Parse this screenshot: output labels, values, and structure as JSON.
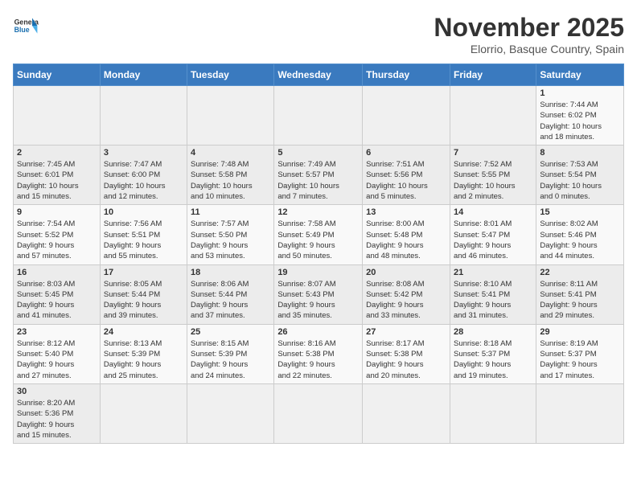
{
  "header": {
    "logo_general": "General",
    "logo_blue": "Blue",
    "month_title": "November 2025",
    "location": "Elorrio, Basque Country, Spain"
  },
  "weekdays": [
    "Sunday",
    "Monday",
    "Tuesday",
    "Wednesday",
    "Thursday",
    "Friday",
    "Saturday"
  ],
  "weeks": [
    [
      {
        "day": "",
        "info": ""
      },
      {
        "day": "",
        "info": ""
      },
      {
        "day": "",
        "info": ""
      },
      {
        "day": "",
        "info": ""
      },
      {
        "day": "",
        "info": ""
      },
      {
        "day": "",
        "info": ""
      },
      {
        "day": "1",
        "info": "Sunrise: 7:44 AM\nSunset: 6:02 PM\nDaylight: 10 hours\nand 18 minutes."
      }
    ],
    [
      {
        "day": "2",
        "info": "Sunrise: 7:45 AM\nSunset: 6:01 PM\nDaylight: 10 hours\nand 15 minutes."
      },
      {
        "day": "3",
        "info": "Sunrise: 7:47 AM\nSunset: 6:00 PM\nDaylight: 10 hours\nand 12 minutes."
      },
      {
        "day": "4",
        "info": "Sunrise: 7:48 AM\nSunset: 5:58 PM\nDaylight: 10 hours\nand 10 minutes."
      },
      {
        "day": "5",
        "info": "Sunrise: 7:49 AM\nSunset: 5:57 PM\nDaylight: 10 hours\nand 7 minutes."
      },
      {
        "day": "6",
        "info": "Sunrise: 7:51 AM\nSunset: 5:56 PM\nDaylight: 10 hours\nand 5 minutes."
      },
      {
        "day": "7",
        "info": "Sunrise: 7:52 AM\nSunset: 5:55 PM\nDaylight: 10 hours\nand 2 minutes."
      },
      {
        "day": "8",
        "info": "Sunrise: 7:53 AM\nSunset: 5:54 PM\nDaylight: 10 hours\nand 0 minutes."
      }
    ],
    [
      {
        "day": "9",
        "info": "Sunrise: 7:54 AM\nSunset: 5:52 PM\nDaylight: 9 hours\nand 57 minutes."
      },
      {
        "day": "10",
        "info": "Sunrise: 7:56 AM\nSunset: 5:51 PM\nDaylight: 9 hours\nand 55 minutes."
      },
      {
        "day": "11",
        "info": "Sunrise: 7:57 AM\nSunset: 5:50 PM\nDaylight: 9 hours\nand 53 minutes."
      },
      {
        "day": "12",
        "info": "Sunrise: 7:58 AM\nSunset: 5:49 PM\nDaylight: 9 hours\nand 50 minutes."
      },
      {
        "day": "13",
        "info": "Sunrise: 8:00 AM\nSunset: 5:48 PM\nDaylight: 9 hours\nand 48 minutes."
      },
      {
        "day": "14",
        "info": "Sunrise: 8:01 AM\nSunset: 5:47 PM\nDaylight: 9 hours\nand 46 minutes."
      },
      {
        "day": "15",
        "info": "Sunrise: 8:02 AM\nSunset: 5:46 PM\nDaylight: 9 hours\nand 44 minutes."
      }
    ],
    [
      {
        "day": "16",
        "info": "Sunrise: 8:03 AM\nSunset: 5:45 PM\nDaylight: 9 hours\nand 41 minutes."
      },
      {
        "day": "17",
        "info": "Sunrise: 8:05 AM\nSunset: 5:44 PM\nDaylight: 9 hours\nand 39 minutes."
      },
      {
        "day": "18",
        "info": "Sunrise: 8:06 AM\nSunset: 5:44 PM\nDaylight: 9 hours\nand 37 minutes."
      },
      {
        "day": "19",
        "info": "Sunrise: 8:07 AM\nSunset: 5:43 PM\nDaylight: 9 hours\nand 35 minutes."
      },
      {
        "day": "20",
        "info": "Sunrise: 8:08 AM\nSunset: 5:42 PM\nDaylight: 9 hours\nand 33 minutes."
      },
      {
        "day": "21",
        "info": "Sunrise: 8:10 AM\nSunset: 5:41 PM\nDaylight: 9 hours\nand 31 minutes."
      },
      {
        "day": "22",
        "info": "Sunrise: 8:11 AM\nSunset: 5:41 PM\nDaylight: 9 hours\nand 29 minutes."
      }
    ],
    [
      {
        "day": "23",
        "info": "Sunrise: 8:12 AM\nSunset: 5:40 PM\nDaylight: 9 hours\nand 27 minutes."
      },
      {
        "day": "24",
        "info": "Sunrise: 8:13 AM\nSunset: 5:39 PM\nDaylight: 9 hours\nand 25 minutes."
      },
      {
        "day": "25",
        "info": "Sunrise: 8:15 AM\nSunset: 5:39 PM\nDaylight: 9 hours\nand 24 minutes."
      },
      {
        "day": "26",
        "info": "Sunrise: 8:16 AM\nSunset: 5:38 PM\nDaylight: 9 hours\nand 22 minutes."
      },
      {
        "day": "27",
        "info": "Sunrise: 8:17 AM\nSunset: 5:38 PM\nDaylight: 9 hours\nand 20 minutes."
      },
      {
        "day": "28",
        "info": "Sunrise: 8:18 AM\nSunset: 5:37 PM\nDaylight: 9 hours\nand 19 minutes."
      },
      {
        "day": "29",
        "info": "Sunrise: 8:19 AM\nSunset: 5:37 PM\nDaylight: 9 hours\nand 17 minutes."
      }
    ],
    [
      {
        "day": "30",
        "info": "Sunrise: 8:20 AM\nSunset: 5:36 PM\nDaylight: 9 hours\nand 15 minutes."
      },
      {
        "day": "",
        "info": ""
      },
      {
        "day": "",
        "info": ""
      },
      {
        "day": "",
        "info": ""
      },
      {
        "day": "",
        "info": ""
      },
      {
        "day": "",
        "info": ""
      },
      {
        "day": "",
        "info": ""
      }
    ]
  ]
}
